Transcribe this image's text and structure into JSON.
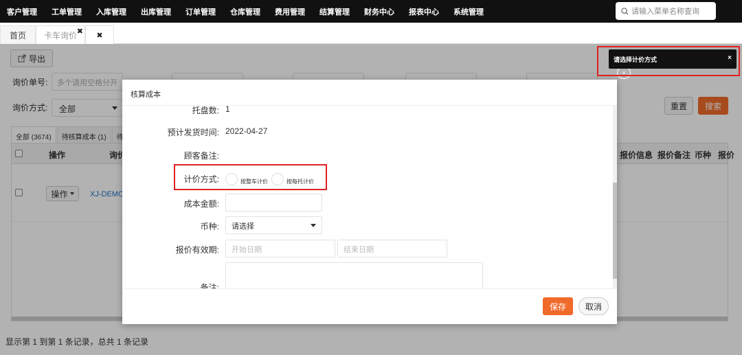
{
  "topnav": {
    "menu": [
      "客户管理",
      "工单管理",
      "入库管理",
      "出库管理",
      "订单管理",
      "仓库管理",
      "费用管理",
      "结算管理",
      "财务中心",
      "报表中心",
      "系统管理"
    ],
    "search_placeholder": "请输入菜单名称查询"
  },
  "tabs": {
    "home": "首页",
    "active": "卡车询价",
    "close_glyph": "✖",
    "close_tab_glyph": "✖"
  },
  "toolbar": {
    "export_label": "导出",
    "reset_label": "重置",
    "search_label": "搜索"
  },
  "filters": {
    "inquiry_no_label": "询价单号:",
    "inquiry_no_placeholder": "多个请用空格分开",
    "pricing_method_label": "询价方式:",
    "pricing_method_value": "全部"
  },
  "subtabs": [
    "全部 (3674)",
    "待核算成本 (1)",
    "待报"
  ],
  "grid": {
    "headers": [
      "操作",
      "询价",
      "报价信息",
      "报价备注",
      "币种",
      "报价"
    ],
    "row": {
      "op_label": "操作",
      "link": "XJ-DEMO-"
    }
  },
  "footer": {
    "summary": "显示第 1 到第 1 条记录，总共 1 条记录"
  },
  "modal": {
    "title": "核算成本",
    "pallets_label": "托盘数:",
    "pallets_value": "1",
    "ship_date_label": "预计发货时间:",
    "ship_date_value": "2022-04-27",
    "remark_label": "顾客备注:",
    "pricing_label": "计价方式:",
    "pricing_options": [
      "按整车计价",
      "按每托计价"
    ],
    "cost_label": "成本金额:",
    "currency_label": "币种:",
    "currency_value": "请选择",
    "validity_label": "报价有效期:",
    "start_placeholder": "开始日期",
    "end_placeholder": "结束日期",
    "note_label": "备注:",
    "save_label": "保存",
    "cancel_label": "取消"
  },
  "toast": {
    "message": "请选择计价方式",
    "close_glyph": "×",
    "ghost_glyph": "×"
  },
  "colors": {
    "accent": "#f06a2a",
    "nav_bg": "#111111",
    "highlight": "#e02020",
    "link": "#1a73c8"
  }
}
